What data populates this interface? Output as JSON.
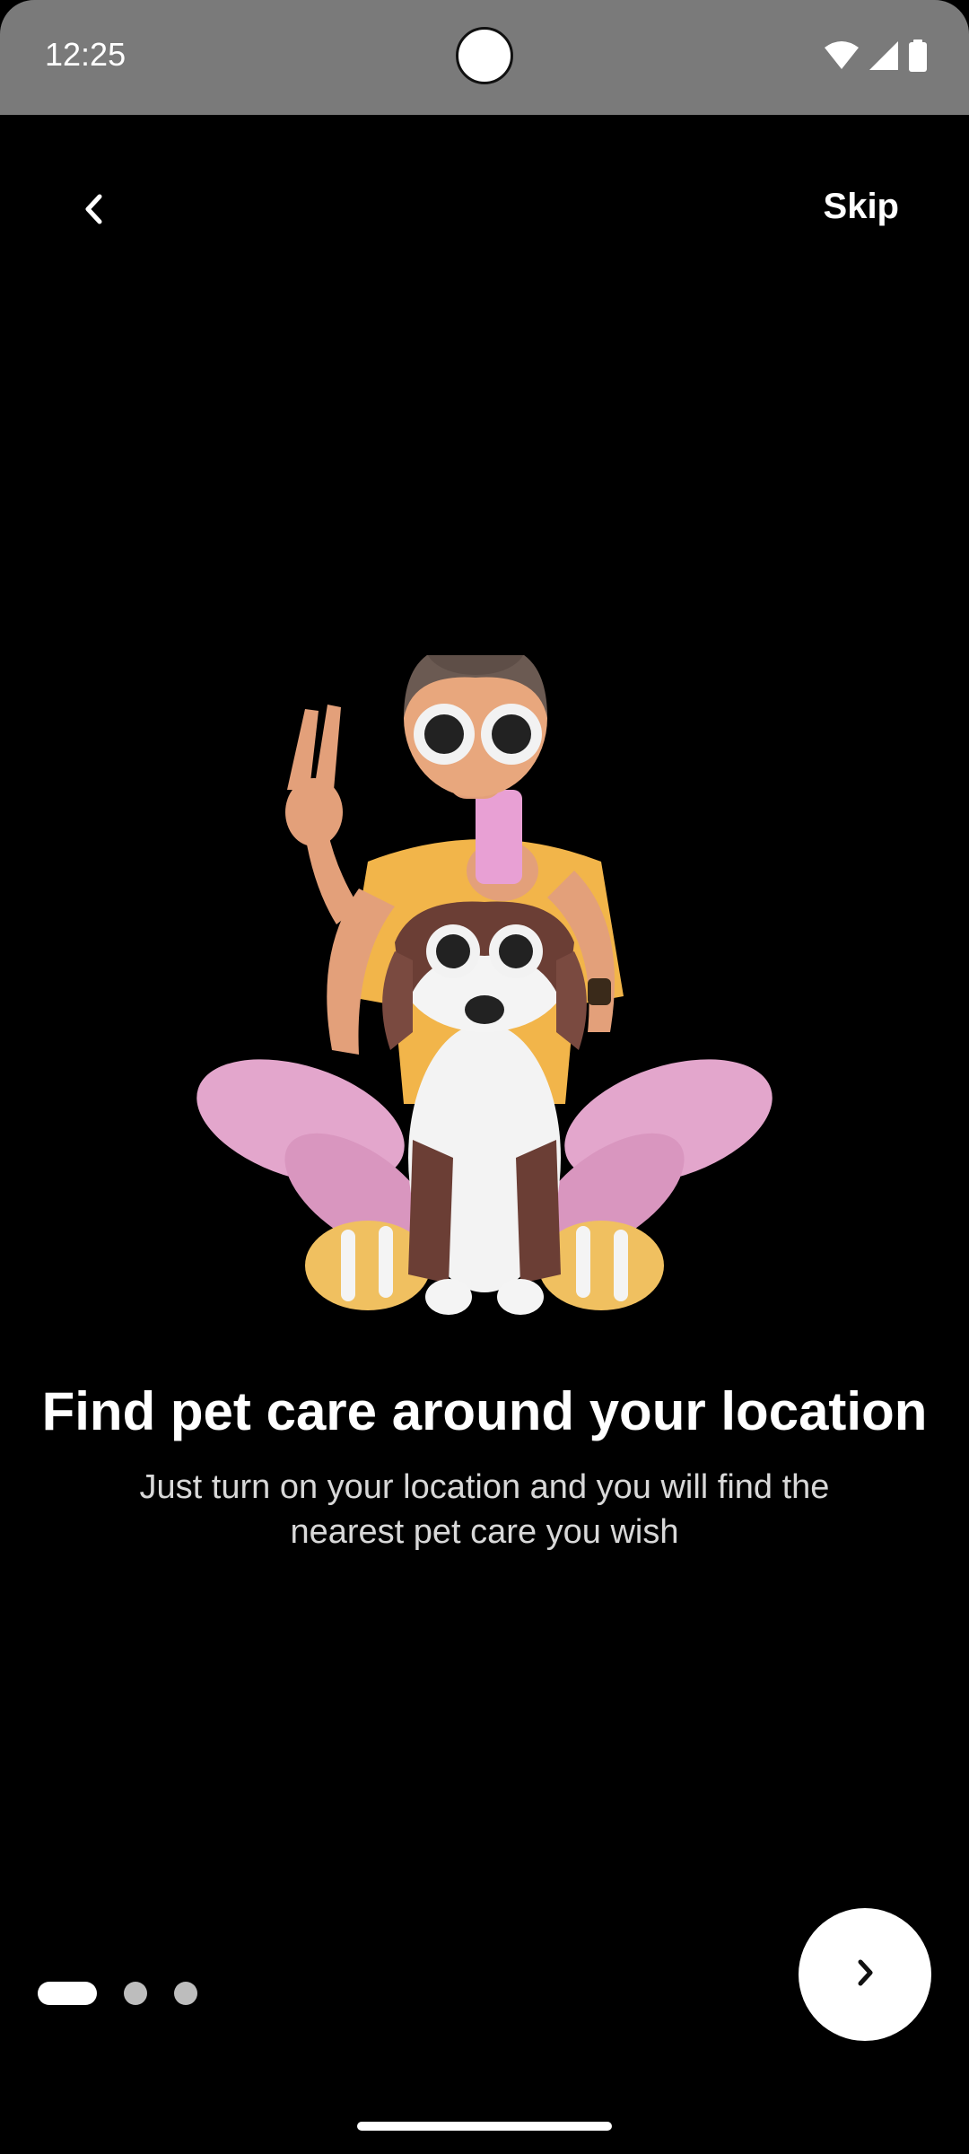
{
  "status_bar": {
    "time": "12:25",
    "icons": [
      "wifi-icon",
      "signal-icon",
      "battery-icon"
    ],
    "background_color": "#7a7a7a"
  },
  "top_bar": {
    "back_icon": "chevron-left-icon",
    "skip_label": "Skip"
  },
  "illustration": {
    "icon": "person-with-dog-illustration"
  },
  "content": {
    "title": "Find pet care around your location",
    "subtitle": "Just turn on your location and you will find the nearest pet care you wish"
  },
  "pagination": {
    "total_pages": 3,
    "current_page": 1,
    "active_color": "#ffffff",
    "inactive_color": "#bdbdbd"
  },
  "next_button": {
    "icon": "chevron-right-icon"
  }
}
